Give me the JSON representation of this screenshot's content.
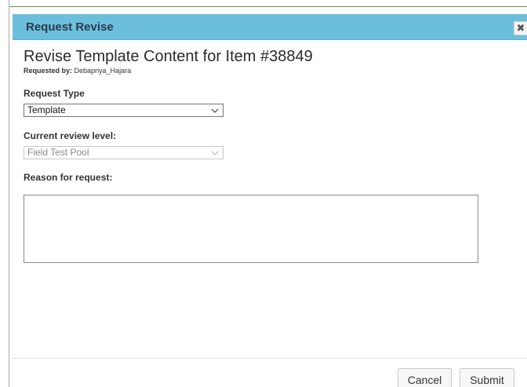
{
  "dialog": {
    "title": "Request Revise",
    "close_glyph": "✖",
    "heading": "Revise Template Content for Item #38849",
    "requested_by_label": "Requested by:",
    "requested_by_value": "Debapriya_Hajara"
  },
  "form": {
    "request_type_label": "Request Type",
    "request_type_value": "Template",
    "review_level_label": "Current review level:",
    "review_level_value": "Field Test Pool",
    "reason_label": "Reason for request:",
    "reason_value": ""
  },
  "footer": {
    "cancel_label": "Cancel",
    "submit_label": "Submit"
  },
  "colors": {
    "titlebar": "#6bbfdc",
    "title_text": "#2b3a4a"
  },
  "icons": {
    "close": "close-icon",
    "dropdown": "chevron-down-icon"
  }
}
